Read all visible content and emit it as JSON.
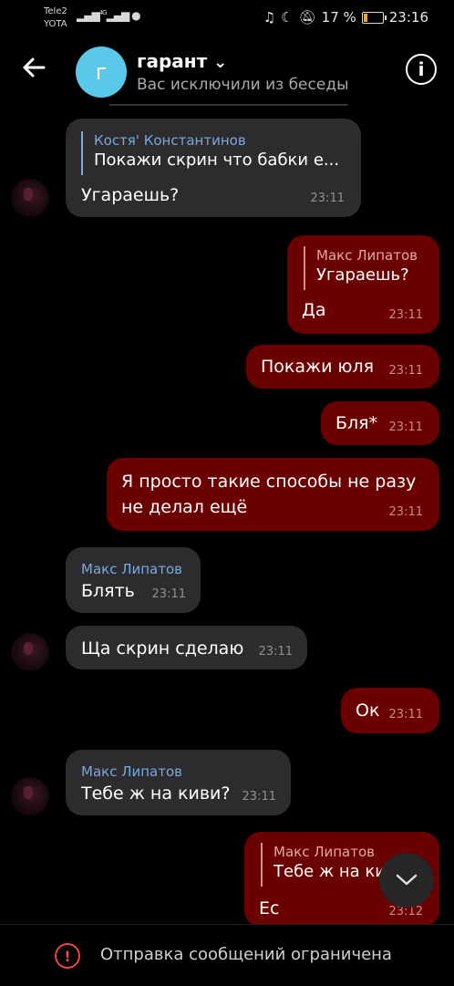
{
  "status_bar": {
    "carrier1": "Tele2",
    "carrier2": "YOTA",
    "signal": "4G",
    "battery": "17 %",
    "battery_level_pct": 17,
    "time": "23:16"
  },
  "header": {
    "back_icon": "arrow-left-icon",
    "avatar_letter": "г",
    "title": "гарант",
    "title_chevron": "⌄",
    "subtitle": "Вас исключили из беседы",
    "info_icon": "i"
  },
  "messages": [
    {
      "id": "m1",
      "type": "in",
      "avatar": true,
      "reply_name": "Костя' Константинов",
      "reply_text": "Покажи скрин что бабки е...",
      "text": "Угараешь?",
      "time": "23:11"
    },
    {
      "id": "m2",
      "type": "out",
      "reply_name": "Макс Липатов",
      "reply_text": "Угараешь?",
      "text": "Да",
      "time": "23:11"
    },
    {
      "id": "m3",
      "type": "out",
      "text": "Покажи юля",
      "time": "23:11"
    },
    {
      "id": "m4",
      "type": "out",
      "text": "Бля*",
      "time": "23:11"
    },
    {
      "id": "m5",
      "type": "out",
      "text_line1": "Я просто такие способы не разу",
      "text_line2": "не делал ещё",
      "time": "23:11"
    },
    {
      "id": "m6",
      "type": "in",
      "sender": "Макс Липатов",
      "text": "Блять",
      "time": "23:11"
    },
    {
      "id": "m7",
      "type": "in",
      "avatar": true,
      "text": "Ща скрин сделаю",
      "time": "23:11"
    },
    {
      "id": "m8",
      "type": "out",
      "text": "Ок",
      "time": "23:11"
    },
    {
      "id": "m9",
      "type": "in",
      "avatar": true,
      "sender": "Макс Липатов",
      "text": "Тебе ж на киви?",
      "time": "23:11"
    },
    {
      "id": "m10",
      "type": "out",
      "reply_name": "Макс Липатов",
      "reply_text": "Тебе ж на киви?",
      "text": "Ес",
      "time": "23:12"
    }
  ],
  "footer": {
    "warning_icon": "!",
    "text": "Отправка сообщений ограничена"
  },
  "colors": {
    "background": "#000000",
    "incoming_bubble": "#2c2c2e",
    "outgoing_bubble": "#6a0000",
    "accent_name": "#7aa7de",
    "avatar_group": "#5ac8e8",
    "warning": "#e84545"
  }
}
